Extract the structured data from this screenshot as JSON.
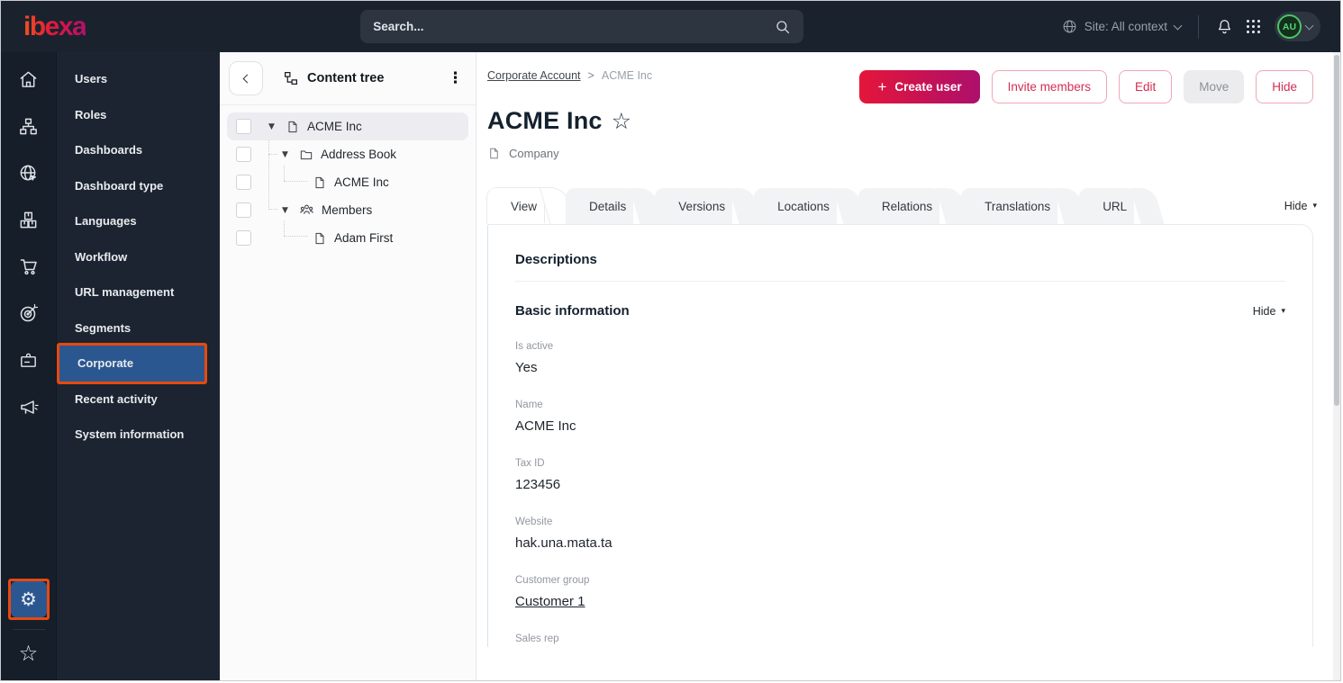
{
  "topbar": {
    "logo": "ibexa",
    "search_placeholder": "Search...",
    "site_context_label": "Site: All context",
    "avatar_initials": "AU"
  },
  "icon_rail": {
    "items": [
      "home",
      "content-structure",
      "site",
      "product-catalog",
      "commerce",
      "personalization",
      "customer-portal",
      "marketing"
    ],
    "settings": "settings",
    "bookmarks": "bookmarks"
  },
  "icons": {
    "gear": "⚙",
    "star_outline": "☆",
    "kebab": "⋮",
    "caret_down": "▼",
    "caret_small": "▾",
    "plus": "+"
  },
  "nav": {
    "items": [
      {
        "label": "Users"
      },
      {
        "label": "Roles"
      },
      {
        "label": "Dashboards"
      },
      {
        "label": "Dashboard type"
      },
      {
        "label": "Languages"
      },
      {
        "label": "Workflow"
      },
      {
        "label": "URL management"
      },
      {
        "label": "Segments"
      },
      {
        "label": "Corporate",
        "active": true
      },
      {
        "label": "Recent activity"
      },
      {
        "label": "System information"
      }
    ]
  },
  "content_tree": {
    "title": "Content tree",
    "nodes": [
      {
        "label": "ACME Inc",
        "depth": 0,
        "icon": "document",
        "expanded": true,
        "selected": true
      },
      {
        "label": "Address Book",
        "depth": 1,
        "icon": "folder",
        "expanded": true
      },
      {
        "label": "ACME Inc",
        "depth": 2,
        "icon": "document"
      },
      {
        "label": "Members",
        "depth": 1,
        "icon": "users-group",
        "expanded": true
      },
      {
        "label": "Adam First",
        "depth": 2,
        "icon": "document"
      }
    ]
  },
  "main": {
    "breadcrumb": {
      "parent": "Corporate Account",
      "separator": ">",
      "current": "ACME Inc"
    },
    "actions": {
      "create_user": "Create user",
      "invite_members": "Invite members",
      "edit": "Edit",
      "move": "Move",
      "hide": "Hide"
    },
    "title": "ACME Inc",
    "content_type": "Company",
    "tabs": [
      {
        "label": "View",
        "active": true
      },
      {
        "label": "Details"
      },
      {
        "label": "Versions"
      },
      {
        "label": "Locations"
      },
      {
        "label": "Relations"
      },
      {
        "label": "Translations"
      },
      {
        "label": "URL"
      }
    ],
    "tabs_toggle": "Hide",
    "section_title": "Descriptions",
    "subsection": {
      "title": "Basic information",
      "toggle": "Hide"
    },
    "fields": [
      {
        "label": "Is active",
        "value": "Yes"
      },
      {
        "label": "Name",
        "value": "ACME Inc"
      },
      {
        "label": "Tax ID",
        "value": "123456"
      },
      {
        "label": "Website",
        "value": "hak.una.mata.ta"
      },
      {
        "label": "Customer group",
        "value": "Customer 1",
        "link": true
      },
      {
        "label": "Sales rep",
        "value": ""
      }
    ]
  },
  "colors": {
    "topbar_bg": "#1a222e",
    "accent_gradient_start": "#e4163a",
    "accent_gradient_end": "#ad0f6b",
    "highlight_blue": "#2b5791",
    "annotation_orange": "#e8490f",
    "avatar_green": "#4cc366"
  }
}
